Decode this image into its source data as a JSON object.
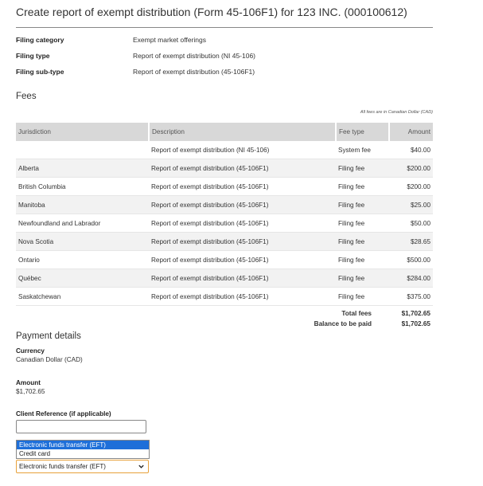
{
  "page": {
    "title": "Create report of exempt distribution (Form 45-106F1) for 123 INC. (000100612)"
  },
  "filing": [
    {
      "label": "Filing category",
      "value": "Exempt market offerings"
    },
    {
      "label": "Filing type",
      "value": "Report of exempt distribution (NI 45-106)"
    },
    {
      "label": "Filing sub-type",
      "value": "Report of exempt distribution (45-106F1)"
    }
  ],
  "fees": {
    "heading": "Fees",
    "note": "All fees are in Canadian Dollar (CAD)",
    "columns": [
      "Jurisdiction",
      "Description",
      "Fee type",
      "Amount"
    ],
    "rows": [
      {
        "jurisdiction": "",
        "description": "Report of exempt distribution (NI 45-106)",
        "fee_type": "System fee",
        "amount": "$40.00"
      },
      {
        "jurisdiction": "Alberta",
        "description": "Report of exempt distribution (45-106F1)",
        "fee_type": "Filing fee",
        "amount": "$200.00"
      },
      {
        "jurisdiction": "British Columbia",
        "description": "Report of exempt distribution (45-106F1)",
        "fee_type": "Filing fee",
        "amount": "$200.00"
      },
      {
        "jurisdiction": "Manitoba",
        "description": "Report of exempt distribution (45-106F1)",
        "fee_type": "Filing fee",
        "amount": "$25.00"
      },
      {
        "jurisdiction": "Newfoundland and Labrador",
        "description": "Report of exempt distribution (45-106F1)",
        "fee_type": "Filing fee",
        "amount": "$50.00"
      },
      {
        "jurisdiction": "Nova Scotia",
        "description": "Report of exempt distribution (45-106F1)",
        "fee_type": "Filing fee",
        "amount": "$28.65"
      },
      {
        "jurisdiction": "Ontario",
        "description": "Report of exempt distribution (45-106F1)",
        "fee_type": "Filing fee",
        "amount": "$500.00"
      },
      {
        "jurisdiction": "Québec",
        "description": "Report of exempt distribution (45-106F1)",
        "fee_type": "Filing fee",
        "amount": "$284.00"
      },
      {
        "jurisdiction": "Saskatchewan",
        "description": "Report of exempt distribution (45-106F1)",
        "fee_type": "Filing fee",
        "amount": "$375.00"
      }
    ],
    "total_label": "Total fees",
    "total_value": "$1,702.65",
    "balance_label": "Balance to be paid",
    "balance_value": "$1,702.65"
  },
  "payment": {
    "heading": "Payment details",
    "currency_label": "Currency",
    "currency_value": "Canadian Dollar (CAD)",
    "amount_label": "Amount",
    "amount_value": "$1,702.65",
    "reference_label": "Client Reference (if applicable)",
    "reference_value": "",
    "method_options": [
      "Electronic funds transfer (EFT)",
      "Credit card"
    ],
    "method_selected": "Electronic funds transfer (EFT)"
  },
  "colors": {
    "header_bg": "#d8d8d8",
    "select_focus_border": "#e8a13a",
    "option_highlight": "#1e6fd9"
  },
  "icons": {
    "select": "chevron-down-icon"
  }
}
